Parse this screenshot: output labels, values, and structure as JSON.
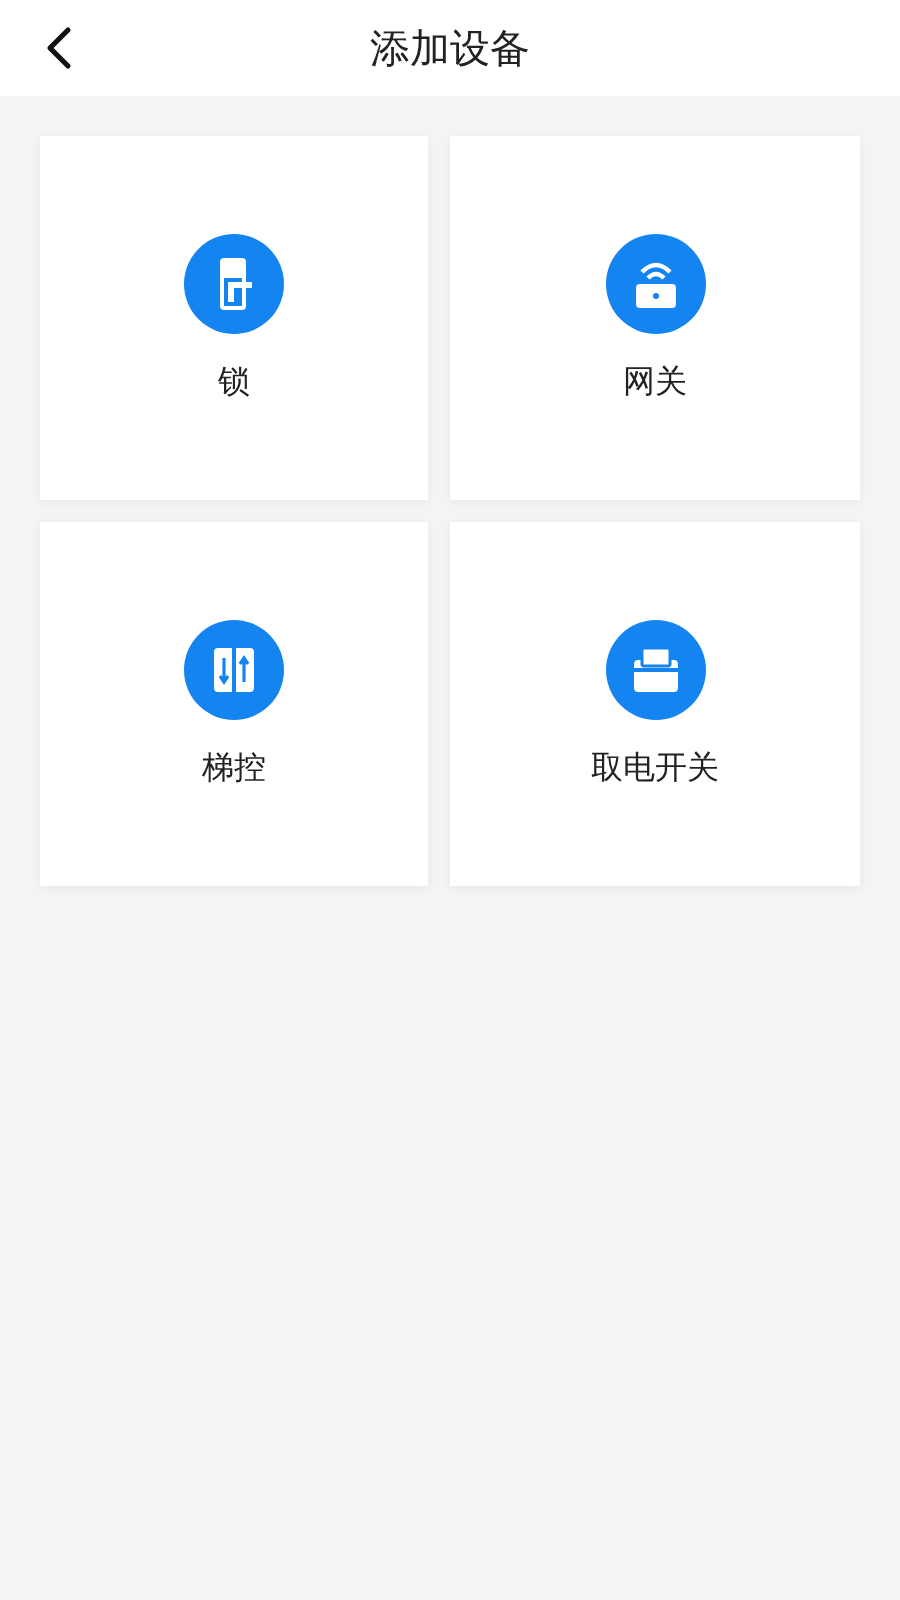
{
  "header": {
    "title": "添加设备"
  },
  "devices": [
    {
      "kind": "lock",
      "label": "锁"
    },
    {
      "kind": "gateway",
      "label": "网关"
    },
    {
      "kind": "elevator",
      "label": "梯控"
    },
    {
      "kind": "power",
      "label": "取电开关"
    }
  ]
}
